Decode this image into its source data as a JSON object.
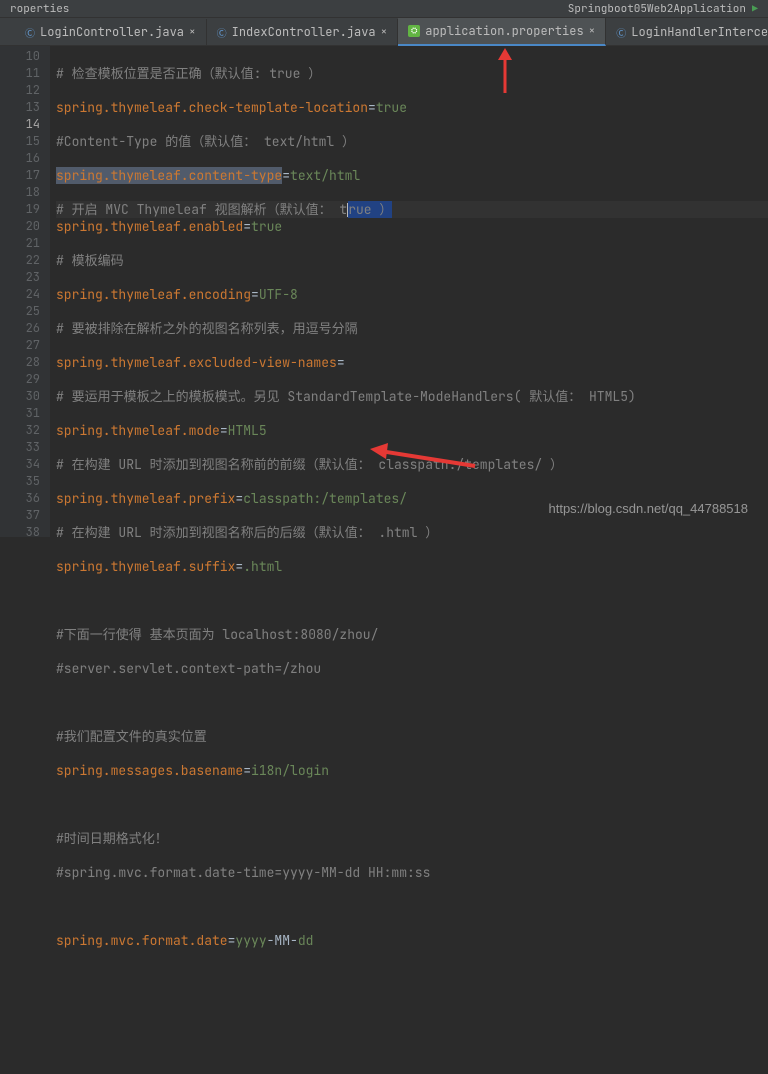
{
  "topbar": {
    "left": "roperties",
    "runConfig": "Springboot05Web2Application",
    "runIcon": "▶"
  },
  "tabs": [
    {
      "label": "LoginController.java",
      "active": false,
      "type": "java"
    },
    {
      "label": "IndexController.java",
      "active": false,
      "type": "java"
    },
    {
      "label": "application.properties",
      "active": true,
      "type": "prop"
    },
    {
      "label": "LoginHandlerInterceptor.java",
      "active": false,
      "type": "java"
    }
  ],
  "gutter": [
    "10",
    "11",
    "12",
    "13",
    "14",
    "15",
    "16",
    "17",
    "18",
    "19",
    "20",
    "21",
    "22",
    "23",
    "24",
    "25",
    "26",
    "27",
    "28",
    "29",
    "30",
    "31",
    "32",
    "33",
    "34",
    "35",
    "36",
    "37",
    "38"
  ],
  "currentLine": "14",
  "code": {
    "l10": "# 检查模板位置是否正确（默认值: true ）",
    "l11k": "spring.thymeleaf.check-template-location",
    "l11v": "true",
    "l12": "#Content-Type 的值（默认值： text/html ）",
    "l13k": "spring.thymeleaf.content-type",
    "l13v": "text/html",
    "l14a": "# 开启 MVC Thymeleaf 视图解析（默认值： t",
    "l14b": "rue ）",
    "l15k": "spring.thymeleaf.enabled",
    "l15v": "true",
    "l16": "# 模板编码",
    "l17k": "spring.thymeleaf.encoding",
    "l17v": "UTF-8",
    "l18": "# 要被排除在解析之外的视图名称列表，用逗号分隔",
    "l19k": "spring.thymeleaf.excluded-view-names",
    "l19v": "",
    "l20": "# 要运用于模板之上的模板模式。另见 StandardTemplate-ModeHandlers( 默认值： HTML5)",
    "l21k": "spring.thymeleaf.mode",
    "l21v": "HTML5",
    "l22": "# 在构建 URL 时添加到视图名称前的前缀（默认值： classpath:/templates/ ）",
    "l23k": "spring.thymeleaf.prefix",
    "l23v": "classpath:/templates/",
    "l24": "# 在构建 URL 时添加到视图名称后的后缀（默认值： .html ）",
    "l25k": "spring.thymeleaf.suffix",
    "l25v": ".html",
    "l27": "#下面一行使得 基本页面为 localhost:8080/zhou/",
    "l28": "#server.servlet.context-path=/zhou",
    "l30": "#我们配置文件的真实位置",
    "l31k": "spring.messages.basename",
    "l31v": "i18n/login",
    "l33": "#时间日期格式化！",
    "l34": "#spring.mvc.format.date-time=yyyy-MM-dd HH:mm:ss",
    "l36k": "spring.mvc.format.date",
    "l36va": "yyyy",
    "l36vb": "-MM-",
    "l36vc": "dd"
  },
  "watermark": "https://blog.csdn.net/qq_44788518"
}
